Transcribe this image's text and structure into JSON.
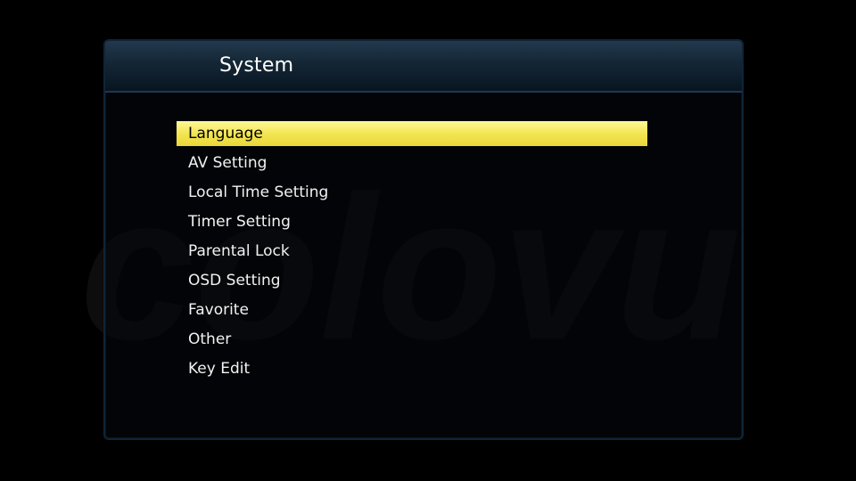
{
  "window": {
    "title": "System"
  },
  "menu": {
    "selected_index": 0,
    "items": [
      {
        "label": "Language"
      },
      {
        "label": "AV Setting"
      },
      {
        "label": "Local Time Setting"
      },
      {
        "label": "Timer Setting"
      },
      {
        "label": "Parental Lock"
      },
      {
        "label": "OSD Setting"
      },
      {
        "label": "Favorite"
      },
      {
        "label": "Other"
      },
      {
        "label": "Key Edit"
      }
    ]
  },
  "watermark": {
    "text": "colovu"
  },
  "colors": {
    "background": "#000000",
    "highlight": "#f3e552",
    "header": "#142635",
    "text": "#f2f2f2"
  }
}
